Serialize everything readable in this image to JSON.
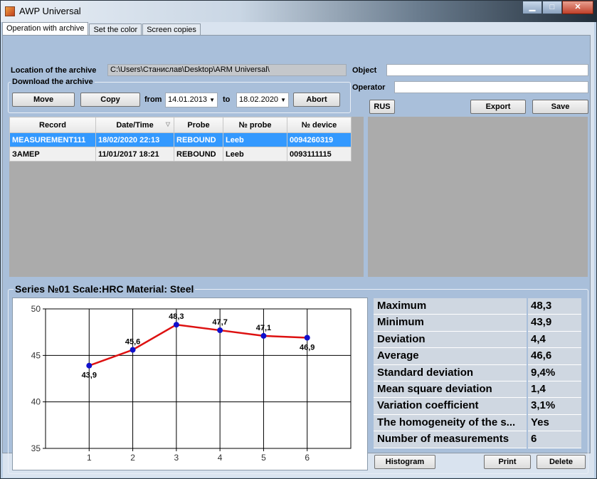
{
  "window": {
    "title": "AWP Universal"
  },
  "tabs": [
    "Operation with archive",
    "Set the color",
    "Screen copies"
  ],
  "archive": {
    "location_label": "Location of the archive",
    "location_value": "C:\\Users\\Станислав\\Desktop\\ARM Universal\\",
    "download_label": "Download the archive",
    "move_btn": "Move",
    "copy_btn": "Copy",
    "from_label": "from",
    "from_date": "14.01.2013",
    "to_label": "to",
    "to_date": "18.02.2020",
    "abort_btn": "Abort"
  },
  "right": {
    "object_label": "Object",
    "object_value": "",
    "operator_label": "Operator",
    "operator_value": "",
    "rus_btn": "RUS",
    "export_btn": "Export",
    "save_btn": "Save"
  },
  "grid": {
    "columns": [
      "Record",
      "Date/Time",
      "Probe",
      "№ probe",
      "№ device"
    ],
    "rows": [
      [
        "MEASUREMENT111",
        "18/02/2020 22:13",
        "REBOUND",
        "Leeb",
        "0094260319"
      ],
      [
        "ЗАМЕР",
        "11/01/2017 18:21",
        "REBOUND",
        "Leeb",
        "0093111115"
      ]
    ]
  },
  "series": {
    "title": "Series №01 Scale:HRC Material: Steel"
  },
  "chart_data": {
    "type": "line",
    "x": [
      1,
      2,
      3,
      4,
      5,
      6
    ],
    "series": [
      {
        "values": [
          43.9,
          45.6,
          48.3,
          47.7,
          47.1,
          46.9
        ]
      }
    ],
    "data_labels": [
      "43,9",
      "45,6",
      "48,3",
      "47,7",
      "47,1",
      "46,9"
    ],
    "xticks": [
      "1",
      "2",
      "3",
      "4",
      "5",
      "6"
    ],
    "yticks": [
      "35",
      "40",
      "45",
      "50"
    ],
    "xlim": [
      0,
      7
    ],
    "ylim": [
      35,
      50
    ],
    "grid": true,
    "line_color": "#dd1111",
    "marker_color": "#1010cc"
  },
  "stats": [
    {
      "label": "Maximum",
      "value": "48,3"
    },
    {
      "label": "Minimum",
      "value": "43,9"
    },
    {
      "label": "Deviation",
      "value": "4,4"
    },
    {
      "label": "Average",
      "value": "46,6"
    },
    {
      "label": "Standard deviation",
      "value": "9,4%"
    },
    {
      "label": "Mean square deviation",
      "value": "1,4"
    },
    {
      "label": "Variation coefficient",
      "value": "3,1%"
    },
    {
      "label": "The homogeneity of the s...",
      "value": "Yes"
    },
    {
      "label": "Number of measurements",
      "value": "6"
    }
  ],
  "bottom": {
    "histogram_btn": "Histogram",
    "print_btn": "Print",
    "delete_btn": "Delete"
  }
}
